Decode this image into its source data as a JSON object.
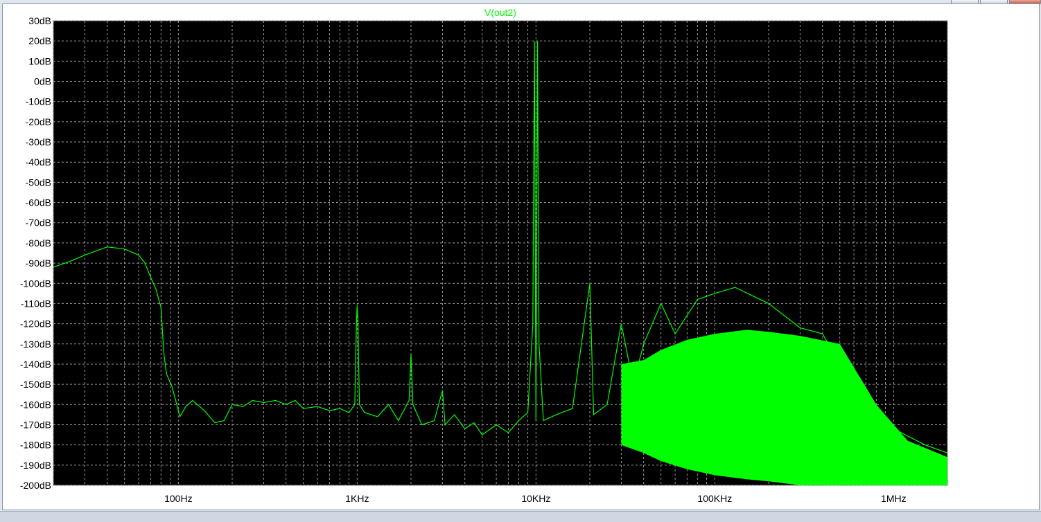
{
  "window": {
    "controls": [
      "minimize-button",
      "maximize-button",
      "close-button"
    ]
  },
  "chart_data": {
    "type": "line",
    "title": "V(out2)",
    "xlabel": "",
    "ylabel": "",
    "x_scale": "log",
    "x_range_hz": [
      20,
      2000000
    ],
    "y_range_db": [
      -200,
      30
    ],
    "grid": true,
    "x_tick_labels": [
      {
        "hz": 100,
        "label": "100Hz"
      },
      {
        "hz": 1000,
        "label": "1KHz"
      },
      {
        "hz": 10000,
        "label": "10KHz"
      },
      {
        "hz": 100000,
        "label": "100KHz"
      },
      {
        "hz": 1000000,
        "label": "1MHz"
      }
    ],
    "y_tick_labels": [
      "30dB",
      "20dB",
      "10dB",
      "0dB",
      "-10dB",
      "-20dB",
      "-30dB",
      "-40dB",
      "-50dB",
      "-60dB",
      "-70dB",
      "-80dB",
      "-90dB",
      "-100dB",
      "-110dB",
      "-120dB",
      "-130dB",
      "-140dB",
      "-150dB",
      "-160dB",
      "-170dB",
      "-180dB",
      "-190dB",
      "-200dB"
    ],
    "colors": {
      "background": "#000000",
      "trace": "#00ff00",
      "title": "#00ff00",
      "grid": "#9a9a9a",
      "tick_text": "#000000"
    },
    "series": [
      {
        "name": "V(out2)",
        "points_hz_db": [
          [
            20,
            -92
          ],
          [
            25,
            -89
          ],
          [
            30,
            -86
          ],
          [
            40,
            -82
          ],
          [
            50,
            -83
          ],
          [
            60,
            -86
          ],
          [
            65,
            -90
          ],
          [
            70,
            -97
          ],
          [
            75,
            -103
          ],
          [
            80,
            -112
          ],
          [
            83,
            -135
          ],
          [
            86,
            -145
          ],
          [
            92,
            -151
          ],
          [
            98,
            -160
          ],
          [
            102,
            -166
          ],
          [
            110,
            -161
          ],
          [
            120,
            -158
          ],
          [
            140,
            -163
          ],
          [
            160,
            -169
          ],
          [
            180,
            -168
          ],
          [
            200,
            -160
          ],
          [
            230,
            -161
          ],
          [
            260,
            -158
          ],
          [
            300,
            -159
          ],
          [
            350,
            -158
          ],
          [
            400,
            -160
          ],
          [
            450,
            -158
          ],
          [
            500,
            -162
          ],
          [
            600,
            -161
          ],
          [
            700,
            -163
          ],
          [
            800,
            -162
          ],
          [
            900,
            -164
          ],
          [
            970,
            -160
          ],
          [
            990,
            -120
          ],
          [
            1000,
            -111
          ],
          [
            1010,
            -118
          ],
          [
            1030,
            -160
          ],
          [
            1100,
            -164
          ],
          [
            1300,
            -166
          ],
          [
            1500,
            -160
          ],
          [
            1700,
            -168
          ],
          [
            1950,
            -158
          ],
          [
            2000,
            -135
          ],
          [
            2050,
            -160
          ],
          [
            2300,
            -170
          ],
          [
            2700,
            -168
          ],
          [
            3000,
            -153
          ],
          [
            3100,
            -170
          ],
          [
            3500,
            -165
          ],
          [
            4000,
            -172
          ],
          [
            4500,
            -169
          ],
          [
            5000,
            -175
          ],
          [
            6000,
            -170
          ],
          [
            7000,
            -174
          ],
          [
            8000,
            -168
          ],
          [
            9000,
            -164
          ],
          [
            9600,
            -120
          ],
          [
            9800,
            20
          ],
          [
            10000,
            -168
          ],
          [
            10200,
            20
          ],
          [
            10400,
            -130
          ],
          [
            11000,
            -168
          ],
          [
            13000,
            -165
          ],
          [
            16000,
            -162
          ],
          [
            20000,
            -100
          ],
          [
            21000,
            -165
          ],
          [
            25000,
            -160
          ],
          [
            30000,
            -120
          ],
          [
            35000,
            -150
          ],
          [
            40000,
            -130
          ],
          [
            50000,
            -110
          ],
          [
            60000,
            -125
          ],
          [
            80000,
            -108
          ],
          [
            100000,
            -105
          ],
          [
            130000,
            -102
          ],
          [
            200000,
            -110
          ],
          [
            300000,
            -122
          ],
          [
            400000,
            -125
          ],
          [
            500000,
            -140
          ],
          [
            700000,
            -160
          ],
          [
            1000000,
            -172
          ],
          [
            1500000,
            -180
          ],
          [
            2000000,
            -184
          ]
        ],
        "envelope_hz_db": [
          [
            30000,
            -180,
            -140
          ],
          [
            40000,
            -184,
            -138
          ],
          [
            50000,
            -188,
            -133
          ],
          [
            70000,
            -192,
            -128
          ],
          [
            100000,
            -195,
            -125
          ],
          [
            150000,
            -197,
            -123
          ],
          [
            200000,
            -198,
            -124
          ],
          [
            300000,
            -200,
            -126
          ],
          [
            500000,
            -200,
            -130
          ],
          [
            800000,
            -200,
            -160
          ],
          [
            1200000,
            -200,
            -178
          ],
          [
            2000000,
            -200,
            -186
          ]
        ]
      }
    ]
  }
}
